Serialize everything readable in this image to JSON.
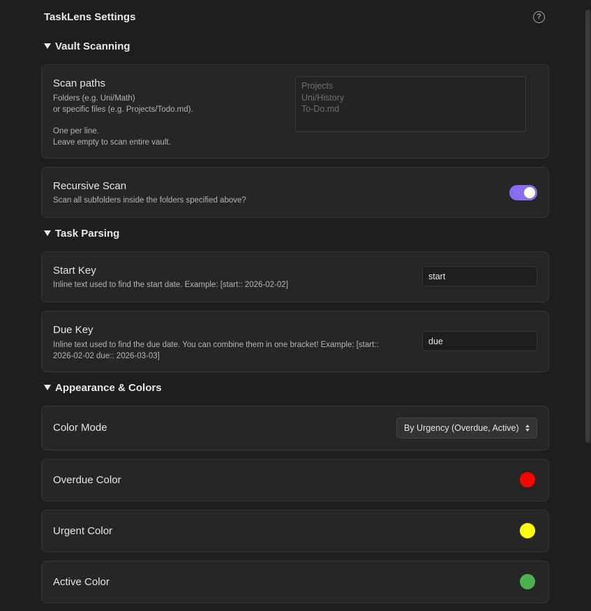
{
  "settings": {
    "title": "TaskLens Settings",
    "help_icon": "question-circle-icon"
  },
  "vault_scanning": {
    "heading": "Vault Scanning",
    "scan_paths": {
      "label": "Scan paths",
      "desc_line1": "Folders (e.g. Uni/Math)",
      "desc_line2": "or specific files (e.g. Projects/Todo.md).",
      "desc_line3": "One per line.",
      "desc_line4": "Leave empty to scan entire vault.",
      "placeholder_line1": "Projects",
      "placeholder_line2": "Uni/History",
      "placeholder_line3": "To-Do.md"
    },
    "recursive_scan": {
      "label": "Recursive Scan",
      "desc": "Scan all subfolders inside the folders specified above?",
      "enabled": true,
      "toggle_color": "#8a6cf0"
    }
  },
  "task_parsing": {
    "heading": "Task Parsing",
    "start_key": {
      "label": "Start Key",
      "desc": "Inline text used to find the start date. Example: [start:: 2026-02-02]",
      "value": "start"
    },
    "due_key": {
      "label": "Due Key",
      "desc_line1": "Inline text used to find the due date. You can combine them in one bracket! Example: [start::",
      "desc_line2": "2026-02-02 due:: 2026-03-03]",
      "value": "due"
    }
  },
  "appearance": {
    "heading": "Appearance & Colors",
    "color_mode": {
      "label": "Color Mode",
      "selected": "By Urgency (Overdue, Active)"
    },
    "overdue_color": {
      "label": "Overdue Color",
      "color": "#ff0000"
    },
    "urgent_color": {
      "label": "Urgent Color",
      "color": "#ffff00"
    },
    "active_color": {
      "label": "Active Color",
      "color": "#4caf50"
    }
  }
}
